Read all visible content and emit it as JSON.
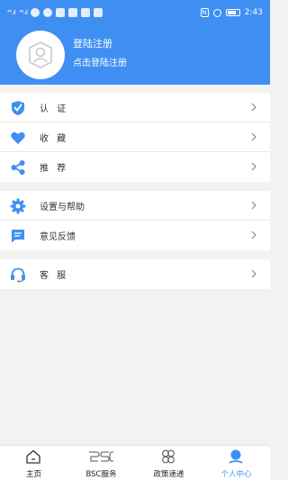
{
  "status_bar": {
    "time": "2:43",
    "signal_1": "⁴⁶.ıl",
    "signal_2": "⁴⁶.ıl",
    "nfc": "N"
  },
  "header": {
    "title": "登陆注册",
    "subtitle": "点击登陆注册"
  },
  "menu_group_1": {
    "items": [
      {
        "label": "认 证",
        "icon": "shield-check-icon"
      },
      {
        "label": "收 藏",
        "icon": "heart-icon"
      },
      {
        "label": "推 荐",
        "icon": "share-icon"
      }
    ]
  },
  "menu_group_2": {
    "items": [
      {
        "label": "设置与帮助",
        "icon": "gear-icon"
      },
      {
        "label": "意见反馈",
        "icon": "message-icon"
      }
    ]
  },
  "menu_group_3": {
    "items": [
      {
        "label": "客 服",
        "icon": "headset-icon"
      }
    ]
  },
  "tabbar": {
    "tabs": [
      {
        "label": "主页",
        "icon": "home-icon",
        "active": false
      },
      {
        "label": "BSC服务",
        "icon": "bsc-logo-icon",
        "active": false
      },
      {
        "label": "政策速递",
        "icon": "policy-icon",
        "active": false
      },
      {
        "label": "个人中心",
        "icon": "user-icon",
        "active": true
      }
    ]
  },
  "colors": {
    "primary": "#3f8ff2",
    "background": "#f2f2f2",
    "text": "#333333"
  }
}
